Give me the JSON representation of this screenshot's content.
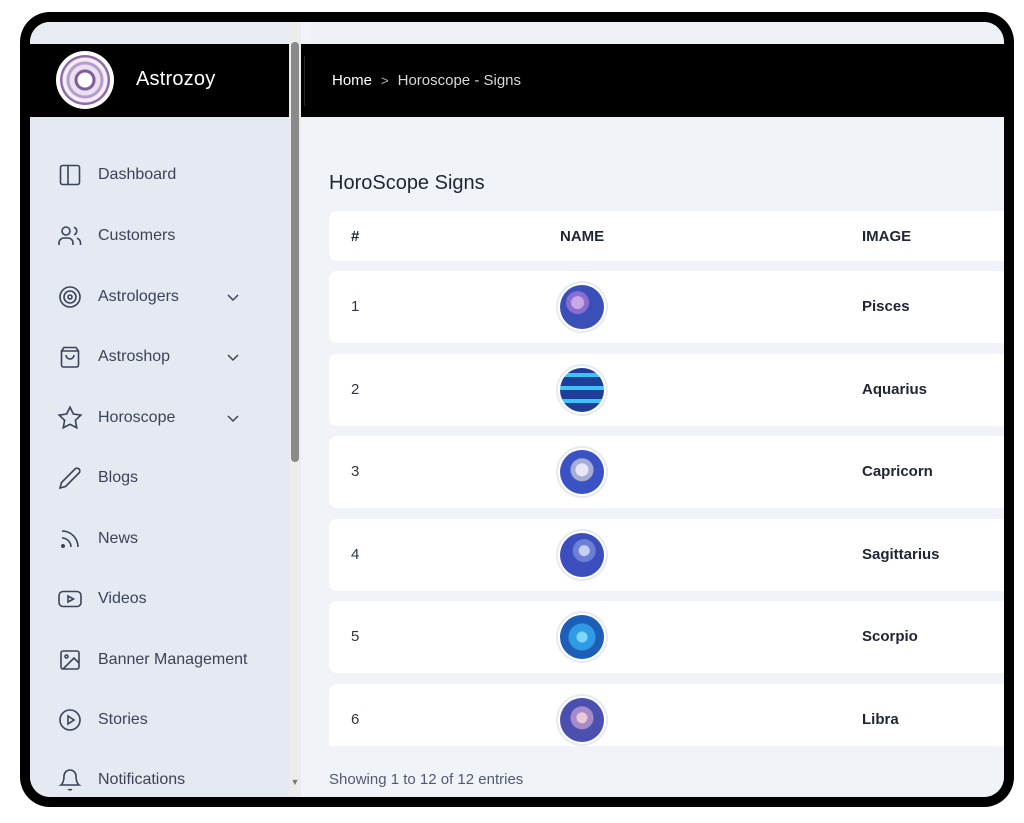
{
  "app": {
    "title": "Astrozoy",
    "logo_icon": "zodiac-wheel-logo"
  },
  "breadcrumb": {
    "home": "Home",
    "separator": ">",
    "current": "Horoscope - Signs"
  },
  "sidebar": {
    "items": [
      {
        "label": "Dashboard",
        "icon": "dashboard-icon",
        "expandable": false
      },
      {
        "label": "Customers",
        "icon": "users-icon",
        "expandable": false
      },
      {
        "label": "Astrologers",
        "icon": "target-icon",
        "expandable": true
      },
      {
        "label": "Astroshop",
        "icon": "shopping-bag-icon",
        "expandable": true
      },
      {
        "label": "Horoscope",
        "icon": "star-icon",
        "expandable": true
      },
      {
        "label": "Blogs",
        "icon": "pencil-icon",
        "expandable": false
      },
      {
        "label": "News",
        "icon": "rss-icon",
        "expandable": false
      },
      {
        "label": "Videos",
        "icon": "youtube-icon",
        "expandable": false
      },
      {
        "label": "Banner Management",
        "icon": "image-icon",
        "expandable": false
      },
      {
        "label": "Stories",
        "icon": "play-circle-icon",
        "expandable": false
      },
      {
        "label": "Notifications",
        "icon": "bell-icon",
        "expandable": false
      }
    ]
  },
  "main": {
    "page_title": "HoroScope Signs",
    "table": {
      "headers": [
        "#",
        "NAME",
        "IMAGE"
      ],
      "rows": [
        {
          "num": "1",
          "name": "Pisces",
          "color": "#3b4fb8"
        },
        {
          "num": "2",
          "name": "Aquarius",
          "color": "#2aa3e0"
        },
        {
          "num": "3",
          "name": "Capricorn",
          "color": "#3a52c4"
        },
        {
          "num": "4",
          "name": "Sagittarius",
          "color": "#3c4dbd"
        },
        {
          "num": "5",
          "name": "Scorpio",
          "color": "#2f9be4"
        },
        {
          "num": "6",
          "name": "Libra",
          "color": "#4a4fb0"
        }
      ]
    },
    "footer": "Showing 1 to 12 of 12 entries"
  },
  "colors": {
    "header_bg": "#000000",
    "sidebar_bg": "#e5e9f1",
    "content_bg": "#f0f3f8",
    "text_dark": "#1f2633"
  }
}
